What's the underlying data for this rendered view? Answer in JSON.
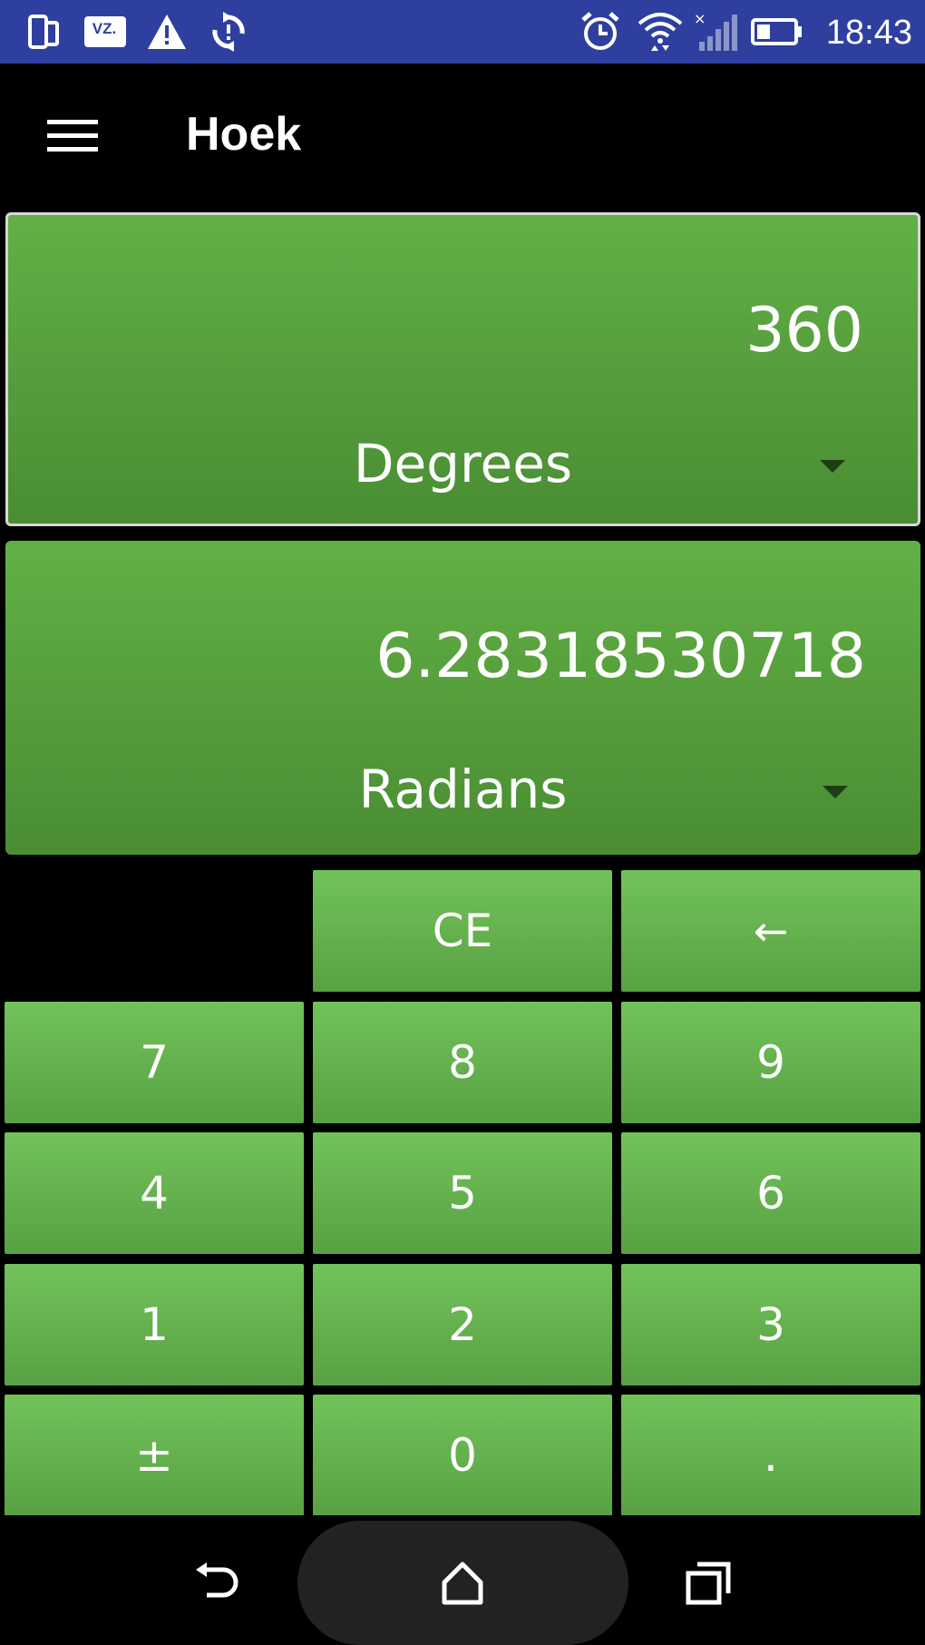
{
  "status_bar": {
    "time": "18:43",
    "left_icons": [
      "phone-screen-icon",
      "vz-badge-icon",
      "warning-icon",
      "sync-icon"
    ],
    "vz_label": "VZ.",
    "right_icons": [
      "alarm-icon",
      "wifi-icon",
      "signal-icon",
      "battery-icon"
    ]
  },
  "toolbar": {
    "title": "Hoek",
    "menu_icon": "hamburger-menu-icon"
  },
  "converter": {
    "from": {
      "value": "360",
      "unit": "Degrees"
    },
    "to": {
      "value": "6.28318530718",
      "unit": "Radians"
    }
  },
  "keypad": {
    "ce": "CE",
    "backspace": "←",
    "k7": "7",
    "k8": "8",
    "k9": "9",
    "k4": "4",
    "k5": "5",
    "k6": "6",
    "k1": "1",
    "k2": "2",
    "k3": "3",
    "plusminus": "±",
    "k0": "0",
    "dot": "."
  },
  "navigation": {
    "back_icon": "back-icon",
    "home_icon": "home-icon",
    "recents_icon": "recents-icon"
  },
  "colors": {
    "status_bar": "#2f3f9f",
    "panel_green": "#5aa640",
    "key_green": "#66b34e",
    "background": "#000000"
  }
}
